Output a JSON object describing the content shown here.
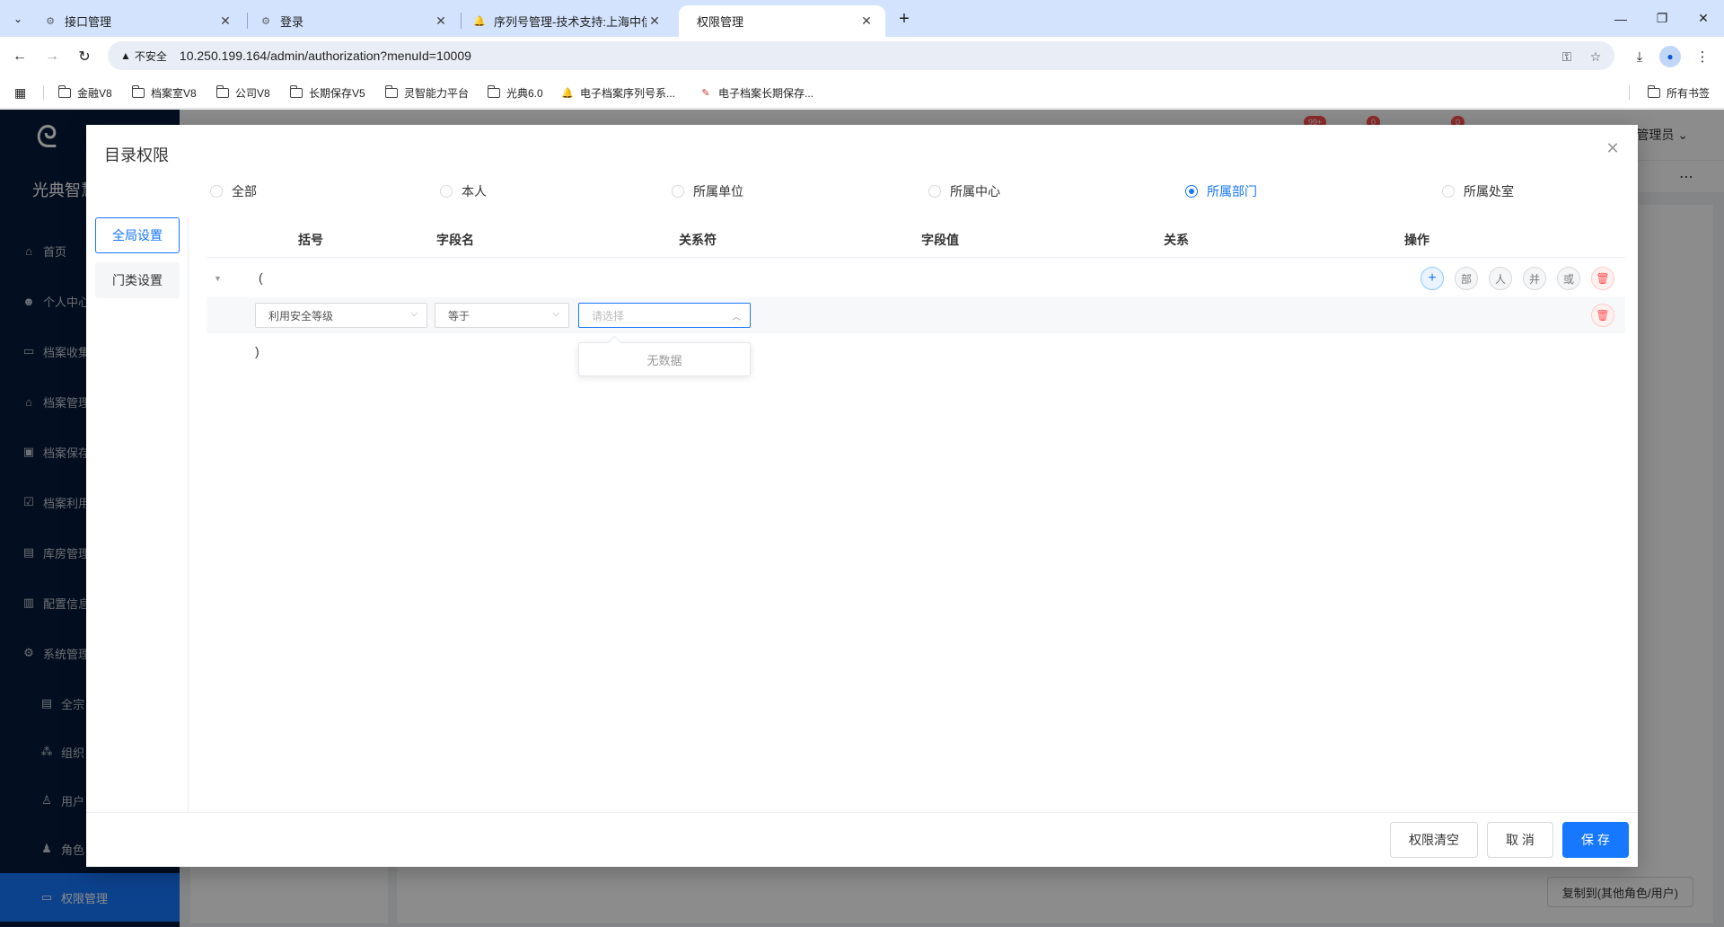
{
  "browser": {
    "tabs": [
      {
        "title": "接口管理",
        "active": false
      },
      {
        "title": "登录",
        "active": false
      },
      {
        "title": "序列号管理-技术支持:上海中信",
        "active": false
      },
      {
        "title": "权限管理",
        "active": true
      }
    ],
    "new_tab_icon": "plus-icon",
    "security_label": "不安全",
    "url": "10.250.199.164/admin/authorization?menuId=10009",
    "bookmarks": [
      {
        "label": "金融V8",
        "icon": "folder-icon"
      },
      {
        "label": "档案室V8",
        "icon": "folder-icon"
      },
      {
        "label": "公司V8",
        "icon": "folder-icon"
      },
      {
        "label": "长期保存V5",
        "icon": "folder-icon"
      },
      {
        "label": "灵智能力平台",
        "icon": "folder-icon"
      },
      {
        "label": "光典6.0",
        "icon": "folder-icon"
      },
      {
        "label": "电子档案序列号系...",
        "icon": "bell-icon"
      },
      {
        "label": "电子档案长期保存...",
        "icon": "site-icon"
      }
    ],
    "all_bookmarks": "所有书签"
  },
  "app": {
    "brand": "光典智慧",
    "menu": [
      {
        "label": "首页",
        "icon": "home-icon"
      },
      {
        "label": "个人中心",
        "icon": "user-icon"
      },
      {
        "label": "档案收集",
        "icon": "inbox-icon"
      },
      {
        "label": "档案管理",
        "icon": "bank-icon"
      },
      {
        "label": "档案保存",
        "icon": "archive-icon"
      },
      {
        "label": "档案利用",
        "icon": "check-icon"
      },
      {
        "label": "库房管理",
        "icon": "building-icon"
      },
      {
        "label": "配置信息",
        "icon": "clipboard-icon"
      },
      {
        "label": "系统管理",
        "icon": "gear-icon"
      },
      {
        "label": "全宗",
        "icon": "doc-icon",
        "sub": true
      },
      {
        "label": "组织",
        "icon": "org-icon",
        "sub": true
      },
      {
        "label": "用户",
        "icon": "person-icon",
        "sub": true
      },
      {
        "label": "角色",
        "icon": "role-icon",
        "sub": true
      },
      {
        "label": "权限管理",
        "icon": "folder-icon",
        "sub": true,
        "selected": true
      }
    ],
    "header_badges": [
      "99+",
      "0",
      "0"
    ],
    "header_user": "户管理员",
    "copy_button": "复制到(其他角色/用户)"
  },
  "modal": {
    "title": "目录权限",
    "scope_options": [
      {
        "label": "全部",
        "checked": false
      },
      {
        "label": "本人",
        "checked": false
      },
      {
        "label": "所属单位",
        "checked": false
      },
      {
        "label": "所属中心",
        "checked": false
      },
      {
        "label": "所属部门",
        "checked": true
      },
      {
        "label": "所属处室",
        "checked": false
      }
    ],
    "left_tabs": [
      {
        "label": "全局设置",
        "active": true
      },
      {
        "label": "门类设置",
        "active": false
      }
    ],
    "columns": [
      "括号",
      "字段名",
      "关系符",
      "字段值",
      "关系",
      "操作"
    ],
    "open_paren": "(",
    "close_paren": ")",
    "condition": {
      "field": "利用安全等级",
      "operator": "等于",
      "value_placeholder": "请选择",
      "dropdown_empty": "无数据"
    },
    "group_ops": [
      {
        "label": "+",
        "icon": "plus-icon"
      },
      {
        "label": "部"
      },
      {
        "label": "人"
      },
      {
        "label": "并"
      },
      {
        "label": "或"
      },
      {
        "label": "🗑",
        "icon": "trash-icon"
      }
    ],
    "row_delete_icon": "trash-icon",
    "footer": {
      "clear": "权限清空",
      "cancel": "取 消",
      "save": "保 存"
    }
  }
}
